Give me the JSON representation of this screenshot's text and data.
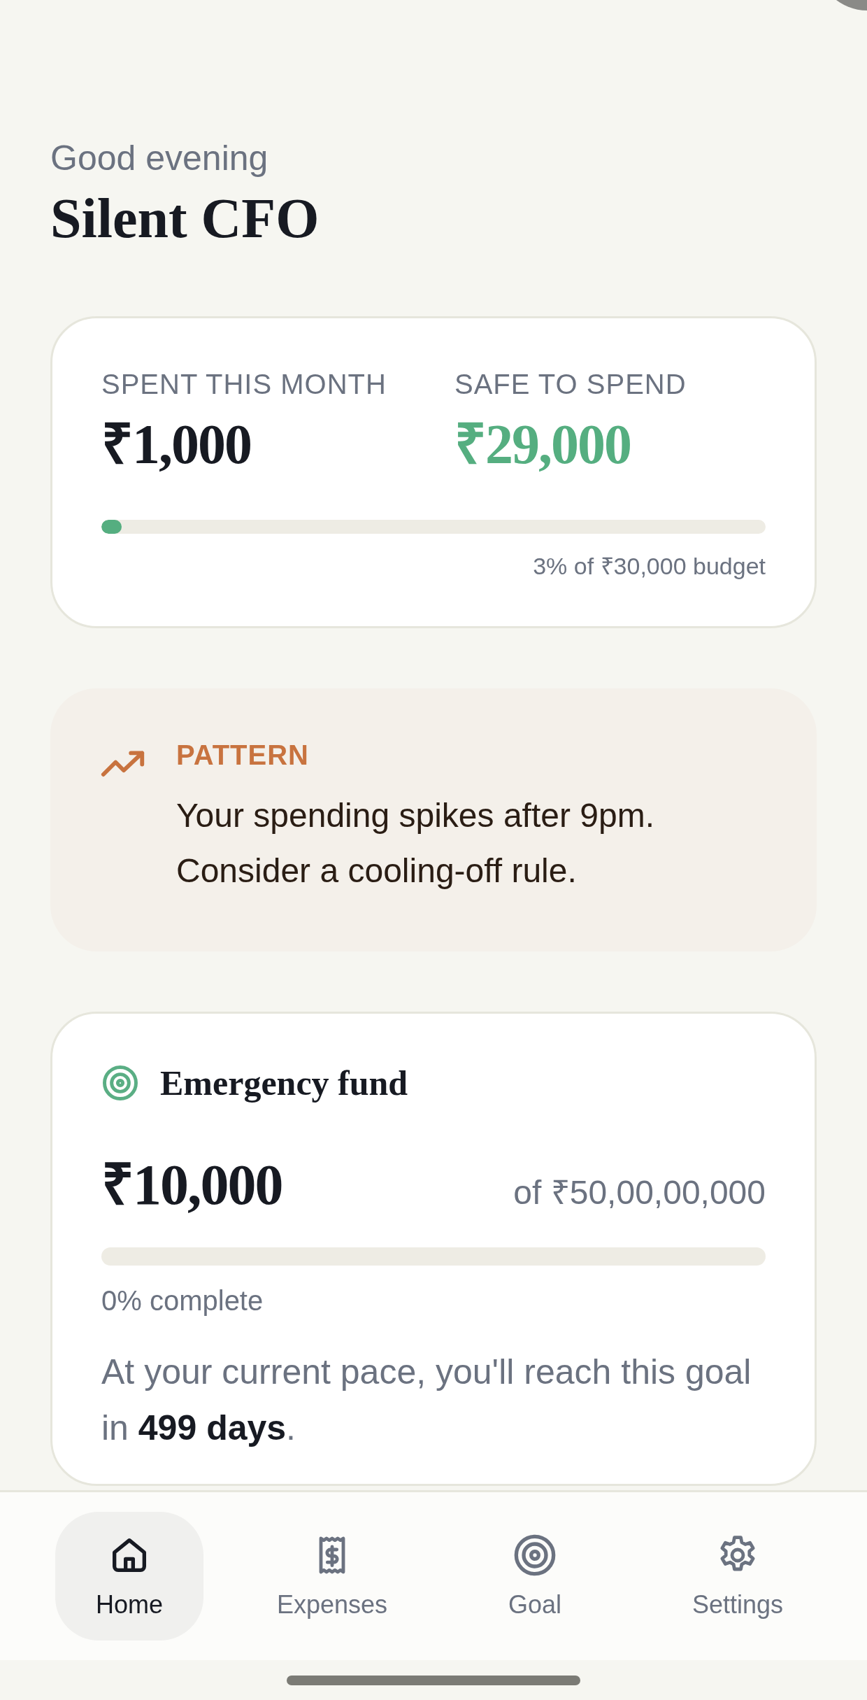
{
  "header": {
    "greeting": "Good evening",
    "title": "Silent CFO"
  },
  "budget_card": {
    "spent_label": "SPENT THIS MONTH",
    "spent_value": "₹1,000",
    "safe_label": "SAFE TO SPEND",
    "safe_value": "₹29,000",
    "level": 0.03,
    "caption": "3% of ₹30,000 budget"
  },
  "insight": {
    "label": "PATTERN",
    "text": "Your spending spikes after 9pm. Consider a cooling-off rule."
  },
  "goal_card": {
    "title": "Emergency fund",
    "amount": "₹10,000",
    "target": "of ₹50,00,00,000",
    "level": 0,
    "caption": "0% complete",
    "message": "At your current pace, you'll reach this goal in **499 days**."
  },
  "nav": [
    {
      "label": "Home",
      "kind": "home",
      "selected": true
    },
    {
      "label": "Expenses",
      "kind": "receipt",
      "selected": false
    },
    {
      "label": "Goal",
      "kind": "target",
      "selected": false
    },
    {
      "label": "Settings",
      "kind": "gear",
      "selected": false
    }
  ]
}
